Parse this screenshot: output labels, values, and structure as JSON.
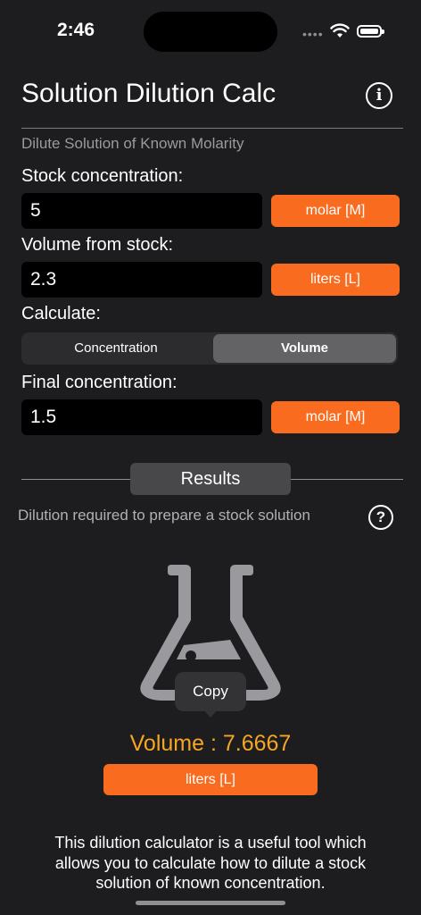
{
  "status": {
    "time": "2:46"
  },
  "header": {
    "title": "Solution Dilution Calc"
  },
  "form": {
    "subtitle": "Dilute Solution of Known Molarity",
    "stock_label": "Stock concentration:",
    "stock_value": "5",
    "stock_unit": "molar [M]",
    "volume_label": "Volume from stock:",
    "volume_value": "2.3",
    "volume_unit": "liters [L]",
    "calc_label": "Calculate:",
    "segments": [
      "Concentration",
      "Volume"
    ],
    "selected_segment": "Volume",
    "final_label": "Final concentration:",
    "final_value": "1.5",
    "final_unit": "molar [M]"
  },
  "results": {
    "button_label": "Results",
    "help_text": "Dilution required to prepare a stock solution",
    "copy_label": "Copy",
    "value_text": "Volume : 7.6667",
    "unit": "liters [L]"
  },
  "footer": {
    "description": "This dilution calculator is a useful tool which allows you to calculate how to dilute a stock solution of known concentration."
  },
  "colors": {
    "accent": "#f96c1f",
    "result": "#f7a524",
    "background": "#1d1d1f"
  },
  "icons": {
    "info": "info-circle-icon",
    "help": "question-circle-icon",
    "flask": "flask-icon"
  }
}
